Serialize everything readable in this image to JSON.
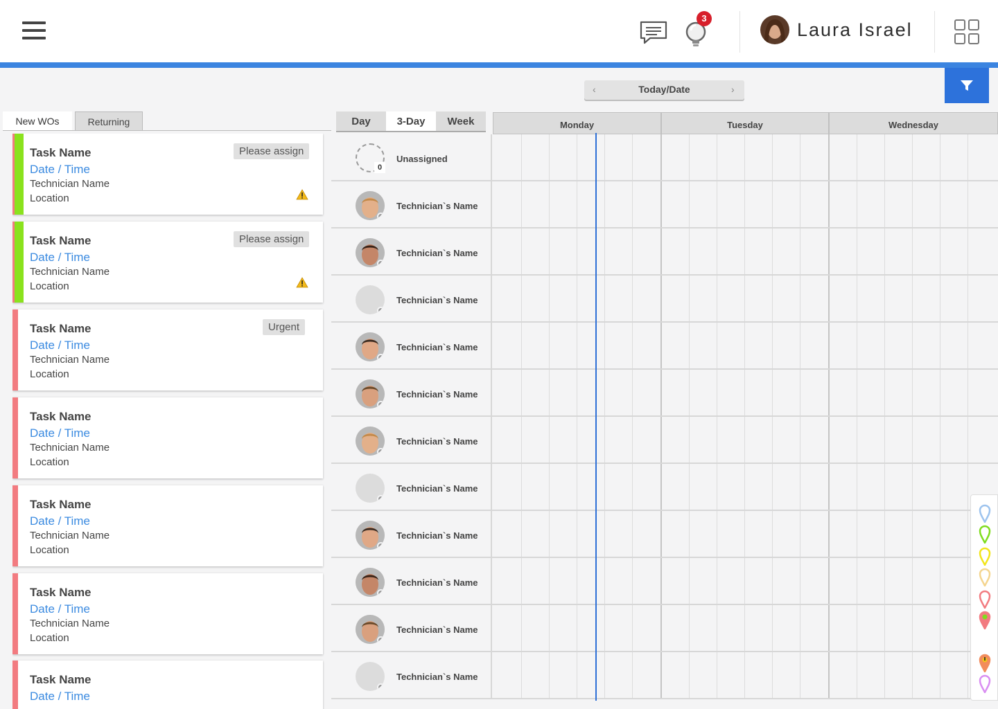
{
  "header": {
    "notification_count": "3",
    "user_name": "Laura Israel"
  },
  "toolbar": {
    "date_label": "Today/Date",
    "prev_arrow": "‹",
    "next_arrow": "›"
  },
  "wo_tabs": [
    {
      "label": "New WOs",
      "active": true
    },
    {
      "label": "Returning",
      "active": false
    }
  ],
  "work_orders": [
    {
      "task": "Task Name",
      "datetime": "Date / Time",
      "technician": "Technician Name",
      "location": "Location",
      "tag": "Please assign",
      "status_color": "#8ae21d",
      "warning": true
    },
    {
      "task": "Task Name",
      "datetime": "Date / Time",
      "technician": "Technician Name",
      "location": "Location",
      "tag": "Please assign",
      "status_color": "#8ae21d",
      "warning": true
    },
    {
      "task": "Task Name",
      "datetime": "Date / Time",
      "technician": "Technician Name",
      "location": "Location",
      "tag": "Urgent",
      "status_color": "#f27b80",
      "warning": false
    },
    {
      "task": "Task Name",
      "datetime": "Date / Time",
      "technician": "Technician Name",
      "location": "Location",
      "tag": "",
      "status_color": "#f27b80",
      "warning": false
    },
    {
      "task": "Task Name",
      "datetime": "Date / Time",
      "technician": "Technician Name",
      "location": "Location",
      "tag": "",
      "status_color": "#f27b80",
      "warning": false
    },
    {
      "task": "Task Name",
      "datetime": "Date / Time",
      "technician": "Technician Name",
      "location": "Location",
      "tag": "",
      "status_color": "#f27b80",
      "warning": false
    },
    {
      "task": "Task Name",
      "datetime": "Date / Time",
      "technician": "",
      "location": "",
      "tag": "",
      "status_color": "#f27b80",
      "warning": false
    }
  ],
  "view_tabs": [
    {
      "label": "Day",
      "active": false
    },
    {
      "label": "3-Day",
      "active": true
    },
    {
      "label": "Week",
      "active": false
    }
  ],
  "days": [
    "Monday",
    "Tuesday",
    "Wednesday"
  ],
  "unassigned": {
    "label": "Unassigned",
    "count": "0"
  },
  "technicians": [
    {
      "name": "Technician`s Name",
      "avatar": "face-a"
    },
    {
      "name": "Technician`s Name",
      "avatar": "face-b"
    },
    {
      "name": "Technician`s Name",
      "avatar": "none"
    },
    {
      "name": "Technician`s Name",
      "avatar": "face-c"
    },
    {
      "name": "Technician`s Name",
      "avatar": "face-d"
    },
    {
      "name": "Technician`s Name",
      "avatar": "face-a"
    },
    {
      "name": "Technician`s Name",
      "avatar": "none"
    },
    {
      "name": "Technician`s Name",
      "avatar": "face-c"
    },
    {
      "name": "Technician`s Name",
      "avatar": "face-b"
    },
    {
      "name": "Technician`s Name",
      "avatar": "face-d"
    },
    {
      "name": "Technician`s Name",
      "avatar": "none"
    }
  ],
  "pin_legend": [
    {
      "icon": "pin-icon",
      "color": "#9dc3ee"
    },
    {
      "icon": "pin-icon",
      "color": "#7fdc1e"
    },
    {
      "icon": "pin-icon",
      "color": "#f2e51a"
    },
    {
      "icon": "pin-icon",
      "color": "#f4d58f"
    },
    {
      "icon": "pin-icon",
      "color": "#f27b80"
    },
    {
      "icon": "pin-icon",
      "color": "#f27b80",
      "center": "#7fdc1e"
    },
    {
      "icon": "pin-warning-icon",
      "color": "#f28c5c",
      "center": "#f2c31a"
    },
    {
      "icon": "pin-icon",
      "color": "#d98ef2"
    }
  ]
}
